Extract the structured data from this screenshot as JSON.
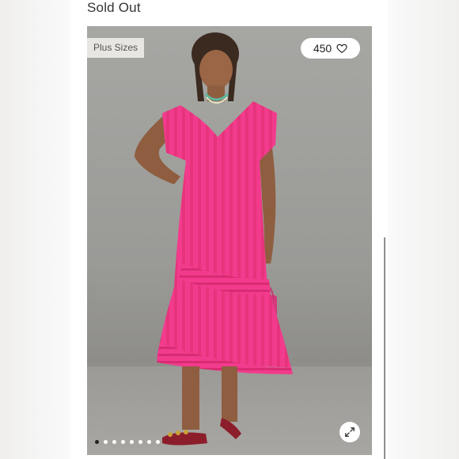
{
  "listing": {
    "status_label": "Sold Out",
    "badge_label": "Plus Sizes",
    "like_count": "450",
    "like_icon": "heart-icon",
    "expand_icon": "expand-icon",
    "carousel": {
      "total": 8,
      "active_index": 0
    }
  },
  "colors": {
    "dress_pink": "#f23b8d",
    "stripe_pink": "#e6337c",
    "background_gray": "#9e9e9b"
  }
}
